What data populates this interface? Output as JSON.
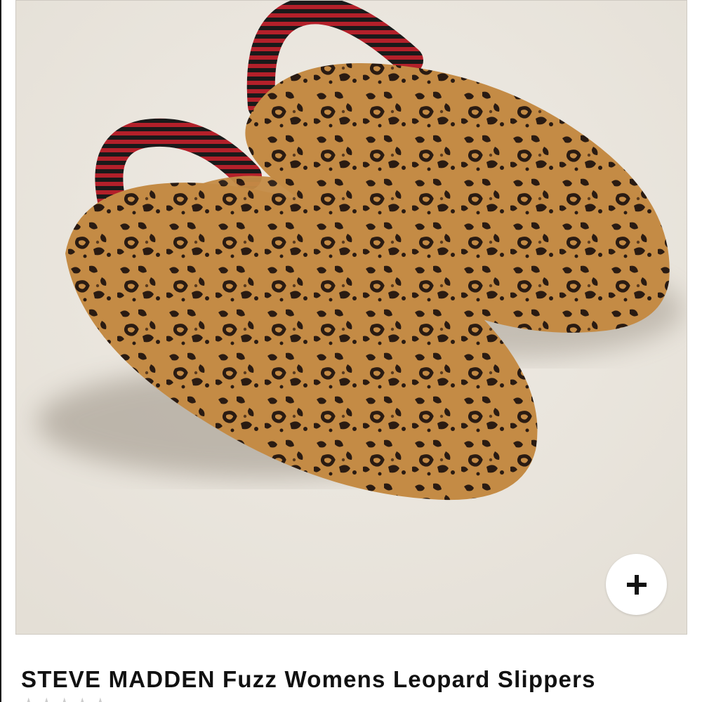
{
  "product": {
    "brand": "STEVE MADDEN",
    "name": "Fuzz Womens Leopard Slippers",
    "image": {
      "subject": "leopard-print fuzzy slingback slippers",
      "background_color": "#ebe7e0",
      "fur_color": "#c48b45",
      "spot_color": "#2a1b12",
      "strap_colors": [
        "#1a1a1a",
        "#b3202a"
      ]
    },
    "add_button": {
      "icon": "plus-icon"
    },
    "rating": {
      "icon": "star-icon",
      "stars": "★★★★★"
    }
  }
}
